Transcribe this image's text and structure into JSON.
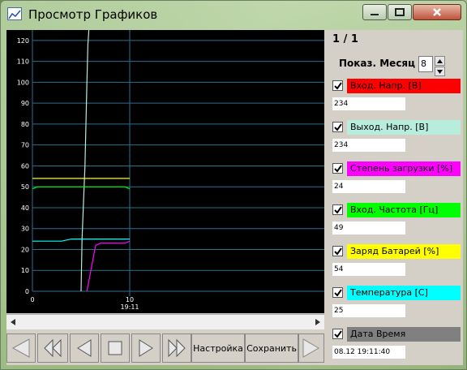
{
  "window": {
    "title": "Просмотр Графиков",
    "icon": "chart-icon"
  },
  "panel": {
    "page_indicator": "1 / 1",
    "month_label": "Показ. Месяц",
    "month_value": "8",
    "series": [
      {
        "label": "Вход. Напр. [В]",
        "color": "#ff0000",
        "checked": true,
        "value": "234"
      },
      {
        "label": "Выход. Напр. [В]",
        "color": "#b8ecdc",
        "checked": true,
        "value": "234"
      },
      {
        "label": "Степень загрузки [%]",
        "color": "#ff00ff",
        "checked": true,
        "value": "24"
      },
      {
        "label": "Вход. Частота [Гц]",
        "color": "#00ff00",
        "checked": true,
        "value": "49"
      },
      {
        "label": "Заряд Батарей [%]",
        "color": "#ffff00",
        "checked": true,
        "value": "54"
      },
      {
        "label": "Температура [C]",
        "color": "#00ffff",
        "checked": true,
        "value": "25"
      },
      {
        "label": "Дата Время",
        "color": "#808080",
        "checked": true,
        "value": "08.12 19:11:40"
      }
    ]
  },
  "toolbar": {
    "settings_label": "Настройка",
    "save_label": "Сохранить"
  },
  "chart_data": {
    "type": "line",
    "ylim": [
      0,
      125
    ],
    "yticks": [
      "0",
      "10",
      "20",
      "30",
      "40",
      "50",
      "60",
      "70",
      "80",
      "90",
      "100",
      "110",
      "120"
    ],
    "xlim": [
      0,
      30
    ],
    "xticks": [
      {
        "x": 0,
        "label": "0",
        "sub": ""
      },
      {
        "x": 10,
        "label": "10",
        "sub": "19:11"
      }
    ],
    "series": [
      {
        "color": "#b8ecdc",
        "x": [
          5.0,
          5.1,
          5.4,
          5.6,
          5.7,
          5.8
        ],
        "y": [
          0,
          25,
          60,
          100,
          118,
          125
        ]
      },
      {
        "color": "#ffff00",
        "x": [
          0,
          10
        ],
        "y": [
          54,
          54
        ]
      },
      {
        "color": "#00ff00",
        "x": [
          0,
          0.5,
          9.5,
          10
        ],
        "y": [
          49,
          50,
          50,
          49
        ]
      },
      {
        "color": "#00ffff",
        "x": [
          0,
          3,
          4,
          10
        ],
        "y": [
          24,
          24,
          25,
          25
        ]
      },
      {
        "color": "#ff00ff",
        "x": [
          5.6,
          6.5,
          7,
          9.5,
          10
        ],
        "y": [
          0,
          22,
          23,
          23,
          24
        ]
      }
    ]
  }
}
